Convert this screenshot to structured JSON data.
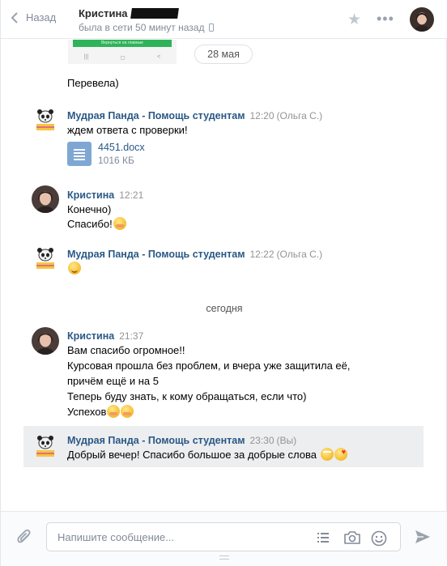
{
  "header": {
    "back_label": "Назад",
    "contact_name": "Кристина",
    "contact_status": "была в сети 50 минут назад"
  },
  "screenshot_preview": {
    "button_text": "Вернуться на главные"
  },
  "date_separator": "28 мая",
  "messages": {
    "m0": {
      "text": "Перевела)"
    },
    "m1": {
      "author": "Мудрая Панда - Помощь студентам",
      "time": "12:20",
      "sender_note": "(Ольга С.)",
      "text": "ждем ответа с проверки!",
      "doc_name": "4451.docx",
      "doc_size": "1016 КБ"
    },
    "m2": {
      "author": "Кристина",
      "time": "12:21",
      "line1": "Конечно)",
      "line2": "Спасибо!"
    },
    "m3": {
      "author": "Мудрая Панда - Помощь студентам",
      "time": "12:22",
      "sender_note": "(Ольга С.)"
    },
    "m4": {
      "author": "Кристина",
      "time": "21:37",
      "line1": "Вам спасибо огромное!!",
      "line2": "Курсовая прошла без проблем, и вчера уже защитила её,",
      "line3": "причём ещё и на 5",
      "line4": "Теперь буду знать, к кому обращаться, если что)",
      "line5": "Успехов"
    },
    "m5": {
      "author": "Мудрая Панда - Помощь студентам",
      "time": "23:30",
      "sender_note": "(Вы)",
      "text": "Добрый вечер! Спасибо большое за добрые слова"
    }
  },
  "day_today": "сегодня",
  "composer": {
    "placeholder": "Напишите сообщение..."
  },
  "colors": {
    "link": "#2a5885",
    "muted": "#828a99",
    "highlight": "#edeef0",
    "doc_icon": "#7fa7d3"
  }
}
